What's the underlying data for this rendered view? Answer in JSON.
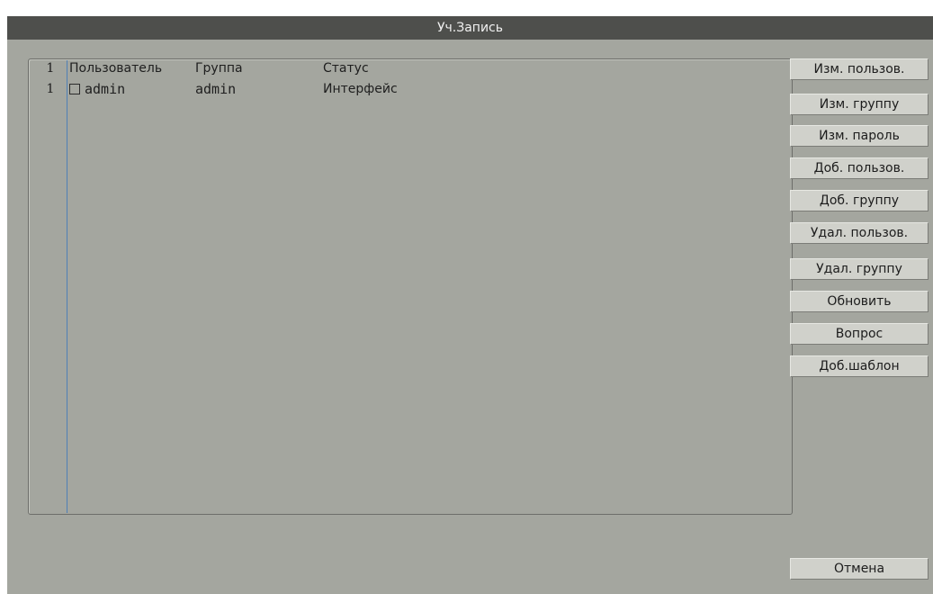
{
  "window": {
    "title": "Уч.Запись"
  },
  "table": {
    "header": {
      "index": "1",
      "user": "Пользователь",
      "group": "Группа",
      "status": "Статус"
    },
    "rows": [
      {
        "index": "1",
        "user": "admin",
        "group": "admin",
        "status": "Интерфейс",
        "checked": false
      }
    ]
  },
  "buttons": {
    "modify_user": "Изм. пользов.",
    "modify_group": "Изм. группу",
    "modify_password": "Изм. пароль",
    "add_user": "Доб. пользов.",
    "add_group": "Доб. группу",
    "delete_user": "Удал. пользов.",
    "delete_group": "Удал. группу",
    "refresh": "Обновить",
    "query": "Вопрос",
    "add_template": "Доб.шаблон",
    "cancel": "Отмена"
  },
  "colors": {
    "titlebar": "#4e4f4c",
    "background": "#a4a69f",
    "button": "#d0d1cb",
    "divider": "#4f7fb6"
  }
}
